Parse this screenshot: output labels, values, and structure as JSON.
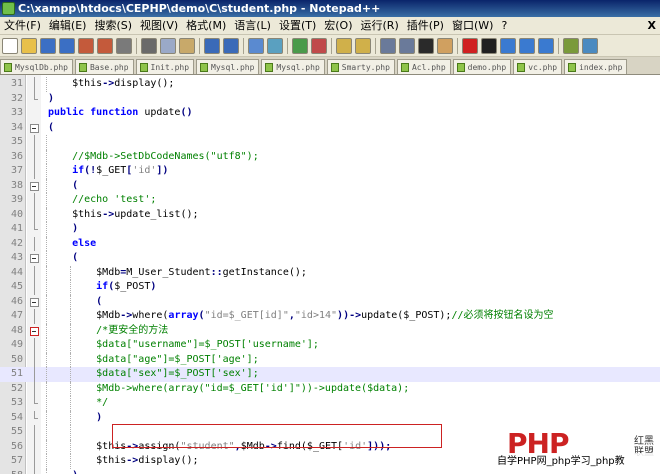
{
  "window": {
    "title": "C:\\xampp\\htdocs\\CEPHP\\demo\\C\\student.php - Notepad++"
  },
  "menu": {
    "items": [
      "文件(F)",
      "编辑(E)",
      "搜索(S)",
      "视图(V)",
      "格式(M)",
      "语言(L)",
      "设置(T)",
      "宏(O)",
      "运行(R)",
      "插件(P)",
      "窗口(W)",
      "?"
    ],
    "close_label": "X"
  },
  "toolbar": {
    "buttons": [
      {
        "icon": "new-file-icon",
        "color": "#ffffff"
      },
      {
        "icon": "open-file-icon",
        "color": "#e8c04a"
      },
      {
        "icon": "save-icon",
        "color": "#3b6fc4"
      },
      {
        "icon": "save-all-icon",
        "color": "#3b6fc4"
      },
      {
        "icon": "close-icon",
        "color": "#c45a3b"
      },
      {
        "icon": "close-all-icon",
        "color": "#c45a3b"
      },
      {
        "icon": "print-icon",
        "color": "#7a7a7a"
      },
      {
        "icon": "cut-icon",
        "color": "#6a6a6a"
      },
      {
        "icon": "copy-icon",
        "color": "#9aa9c8"
      },
      {
        "icon": "paste-icon",
        "color": "#c8a96a"
      },
      {
        "icon": "undo-icon",
        "color": "#3a6ab8"
      },
      {
        "icon": "redo-icon",
        "color": "#3a6ab8"
      },
      {
        "icon": "find-icon",
        "color": "#5a8ad0"
      },
      {
        "icon": "replace-icon",
        "color": "#5aa0c0"
      },
      {
        "icon": "zoom-in-icon",
        "color": "#4a9a4a"
      },
      {
        "icon": "zoom-out-icon",
        "color": "#c04a4a"
      },
      {
        "icon": "sync-v-icon",
        "color": "#d0b04a"
      },
      {
        "icon": "sync-h-icon",
        "color": "#d0b04a"
      },
      {
        "icon": "wrap-icon",
        "color": "#6a7a9a"
      },
      {
        "icon": "all-chars-icon",
        "color": "#6a7a9a"
      },
      {
        "icon": "indent-guide-icon",
        "color": "#2a2a2a"
      },
      {
        "icon": "doc-map-icon",
        "color": "#d0a060"
      },
      {
        "icon": "record-icon",
        "color": "#d02020"
      },
      {
        "icon": "stop-icon",
        "color": "#202020"
      },
      {
        "icon": "play-icon",
        "color": "#3a7ad0"
      },
      {
        "icon": "play-multi-icon",
        "color": "#3a7ad0"
      },
      {
        "icon": "save-macro-icon",
        "color": "#3a7ad0"
      },
      {
        "icon": "spell-icon",
        "color": "#7a9a3a"
      },
      {
        "icon": "abc-check-icon",
        "color": "#4a8ac0"
      }
    ]
  },
  "tabs": [
    "MysqlDb.php",
    "Base.php",
    "Init.php",
    "Mysql.php",
    "Mysql.php",
    "Smarty.php",
    "Acl.php",
    "demo.php",
    "vc.php",
    "index.php"
  ],
  "editor": {
    "highlighted_line": 51,
    "lines": [
      {
        "n": 31,
        "indent": 2,
        "fold": "line",
        "tokens": [
          {
            "t": "tx",
            "v": "$this"
          },
          {
            "t": "op",
            "v": "->"
          },
          {
            "t": "tx",
            "v": "display();"
          }
        ]
      },
      {
        "n": 32,
        "indent": 1,
        "fold": "end",
        "tokens": [
          {
            "t": "op",
            "v": ")"
          }
        ]
      },
      {
        "n": 33,
        "indent": 1,
        "fold": "none",
        "tokens": [
          {
            "t": "kw",
            "v": "public function "
          },
          {
            "t": "tx",
            "v": "update"
          },
          {
            "t": "op",
            "v": "()"
          }
        ]
      },
      {
        "n": 34,
        "indent": 1,
        "fold": "box",
        "tokens": [
          {
            "t": "op",
            "v": "("
          }
        ]
      },
      {
        "n": 35,
        "indent": 2,
        "fold": "line",
        "tokens": []
      },
      {
        "n": 36,
        "indent": 2,
        "fold": "line",
        "tokens": [
          {
            "t": "cm",
            "v": "//$Mdb->SetDbCodeNames(\"utf8\");"
          }
        ]
      },
      {
        "n": 37,
        "indent": 2,
        "fold": "line",
        "tokens": [
          {
            "t": "kw",
            "v": "if"
          },
          {
            "t": "op",
            "v": "(!"
          },
          {
            "t": "tx",
            "v": "$_GET"
          },
          {
            "t": "op",
            "v": "["
          },
          {
            "t": "str",
            "v": "'id'"
          },
          {
            "t": "op",
            "v": "])"
          }
        ]
      },
      {
        "n": 38,
        "indent": 2,
        "fold": "box",
        "tokens": [
          {
            "t": "op",
            "v": "("
          }
        ]
      },
      {
        "n": 39,
        "indent": 2,
        "fold": "line",
        "tokens": [
          {
            "t": "cm",
            "v": "//echo 'test';"
          }
        ]
      },
      {
        "n": 40,
        "indent": 2,
        "fold": "line",
        "tokens": [
          {
            "t": "tx",
            "v": "$this"
          },
          {
            "t": "op",
            "v": "->"
          },
          {
            "t": "tx",
            "v": "update_list();"
          }
        ]
      },
      {
        "n": 41,
        "indent": 2,
        "fold": "end",
        "tokens": [
          {
            "t": "op",
            "v": ")"
          }
        ]
      },
      {
        "n": 42,
        "indent": 2,
        "fold": "line",
        "tokens": [
          {
            "t": "kw",
            "v": "else"
          }
        ]
      },
      {
        "n": 43,
        "indent": 2,
        "fold": "box",
        "tokens": [
          {
            "t": "op",
            "v": "("
          }
        ]
      },
      {
        "n": 44,
        "indent": 3,
        "fold": "line",
        "tokens": [
          {
            "t": "tx",
            "v": "$Mdb"
          },
          {
            "t": "op",
            "v": "="
          },
          {
            "t": "tx",
            "v": "M_User_Student"
          },
          {
            "t": "op",
            "v": "::"
          },
          {
            "t": "tx",
            "v": "getInstance();"
          }
        ]
      },
      {
        "n": 45,
        "indent": 3,
        "fold": "line",
        "tokens": [
          {
            "t": "kw",
            "v": "if"
          },
          {
            "t": "op",
            "v": "("
          },
          {
            "t": "tx",
            "v": "$_POST"
          },
          {
            "t": "op",
            "v": ")"
          }
        ]
      },
      {
        "n": 46,
        "indent": 3,
        "fold": "box",
        "tokens": [
          {
            "t": "op",
            "v": "("
          }
        ]
      },
      {
        "n": 47,
        "indent": 3,
        "fold": "line",
        "tokens": [
          {
            "t": "tx",
            "v": "$Mdb"
          },
          {
            "t": "op",
            "v": "->"
          },
          {
            "t": "tx",
            "v": "where("
          },
          {
            "t": "kw",
            "v": "array"
          },
          {
            "t": "op",
            "v": "("
          },
          {
            "t": "str",
            "v": "\"id=$_GET[id]\""
          },
          {
            "t": "op",
            "v": ","
          },
          {
            "t": "str",
            "v": "\"id>14\""
          },
          {
            "t": "op",
            "v": "))->"
          },
          {
            "t": "tx",
            "v": "update($_POST);"
          },
          {
            "t": "cm",
            "v": "//必须将按钮名设为空"
          }
        ]
      },
      {
        "n": 48,
        "indent": 3,
        "fold": "box-red",
        "tokens": [
          {
            "t": "cm",
            "v": "/*更安全的方法"
          }
        ]
      },
      {
        "n": 49,
        "indent": 3,
        "fold": "line",
        "tokens": [
          {
            "t": "cm",
            "v": "$data[\"username\"]=$_POST['username'];"
          }
        ]
      },
      {
        "n": 50,
        "indent": 3,
        "fold": "line",
        "tokens": [
          {
            "t": "cm",
            "v": "$data[\"age\"]=$_POST['age'];"
          }
        ]
      },
      {
        "n": 51,
        "indent": 3,
        "fold": "line",
        "tokens": [
          {
            "t": "cm",
            "v": "$data[\"sex\"]=$_POST['sex'];"
          }
        ]
      },
      {
        "n": 52,
        "indent": 3,
        "fold": "line",
        "tokens": [
          {
            "t": "cm",
            "v": "$Mdb->where(array(\"id=$_GET['id']\"))->update($data);"
          }
        ]
      },
      {
        "n": 53,
        "indent": 3,
        "fold": "end",
        "tokens": [
          {
            "t": "cm",
            "v": "*/"
          }
        ]
      },
      {
        "n": 54,
        "indent": 3,
        "fold": "end",
        "tokens": [
          {
            "t": "op",
            "v": ")"
          }
        ]
      },
      {
        "n": 55,
        "indent": 3,
        "fold": "line",
        "tokens": []
      },
      {
        "n": 56,
        "indent": 3,
        "fold": "line",
        "tokens": [
          {
            "t": "tx",
            "v": "$this"
          },
          {
            "t": "op",
            "v": "->"
          },
          {
            "t": "tx",
            "v": "assign("
          },
          {
            "t": "str",
            "v": "\"student\""
          },
          {
            "t": "op",
            "v": ","
          },
          {
            "t": "tx",
            "v": "$Mdb"
          },
          {
            "t": "op",
            "v": "->"
          },
          {
            "t": "tx",
            "v": "find($_GET["
          },
          {
            "t": "str",
            "v": "'id'"
          },
          {
            "t": "op",
            "v": "]));"
          }
        ]
      },
      {
        "n": 57,
        "indent": 3,
        "fold": "line",
        "tokens": [
          {
            "t": "tx",
            "v": "$this"
          },
          {
            "t": "op",
            "v": "->"
          },
          {
            "t": "tx",
            "v": "display();"
          }
        ]
      },
      {
        "n": 58,
        "indent": 2,
        "fold": "end",
        "tokens": [
          {
            "t": "op",
            "v": ")"
          }
        ]
      }
    ]
  },
  "watermark": {
    "logo": "PHP",
    "side_line1": "红黑",
    "side_line2": "联盟",
    "bar_text": "自学PHP网_php学习_php教"
  }
}
